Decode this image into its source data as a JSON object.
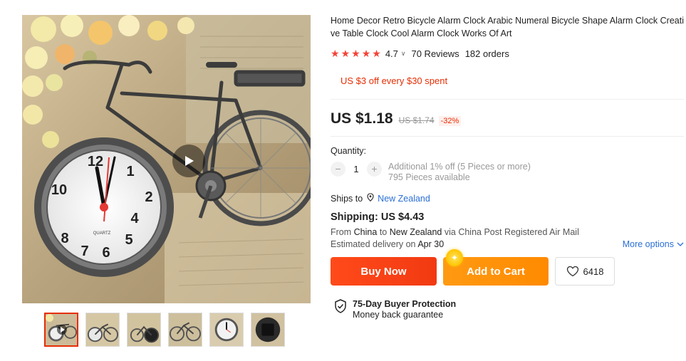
{
  "product": {
    "title": "Home Decor Retro Bicycle Alarm Clock Arabic Numeral Bicycle Shape Alarm Clock Creative Table Clock Cool Alarm Clock Works Of Art",
    "rating": "4.7",
    "stars": 5,
    "reviews": "70 Reviews",
    "orders": "182 orders"
  },
  "promo": {
    "text": "US $3 off every $30 spent"
  },
  "price": {
    "current": "US $1.18",
    "original": "US $1.74",
    "discount": "-32%"
  },
  "quantity": {
    "label": "Quantity:",
    "value": "1",
    "minus_icon": "−",
    "plus_icon": "+",
    "note_line1": "Additional 1% off (5 Pieces or more)",
    "note_line2": "795 Pieces available"
  },
  "ships": {
    "label": "Ships to",
    "country": "New Zealand"
  },
  "shipping": {
    "title": "Shipping: US $4.43",
    "from_prefix": "From",
    "from": "China",
    "to_prefix": "to",
    "to": "New Zealand",
    "via": "via China Post Registered Air Mail",
    "delivery_prefix": "Estimated delivery on",
    "delivery_date": "Apr 30",
    "more_options": "More options"
  },
  "actions": {
    "buy_now": "Buy Now",
    "add_to_cart": "Add to Cart",
    "wishlist_count": "6418"
  },
  "protection": {
    "title": "75-Day Buyer Protection",
    "subtitle": "Money back guarantee"
  },
  "clock_face": {
    "brand": "QUARTZ"
  },
  "gallery": {
    "thumbnail_count": 6,
    "active_index": 0
  },
  "colors": {
    "accent_red": "#e62e04",
    "buy_now": "#f23a12",
    "add_to_cart": "#ff8a00",
    "link_blue": "#2a6fd6",
    "star_red": "#f44336"
  }
}
